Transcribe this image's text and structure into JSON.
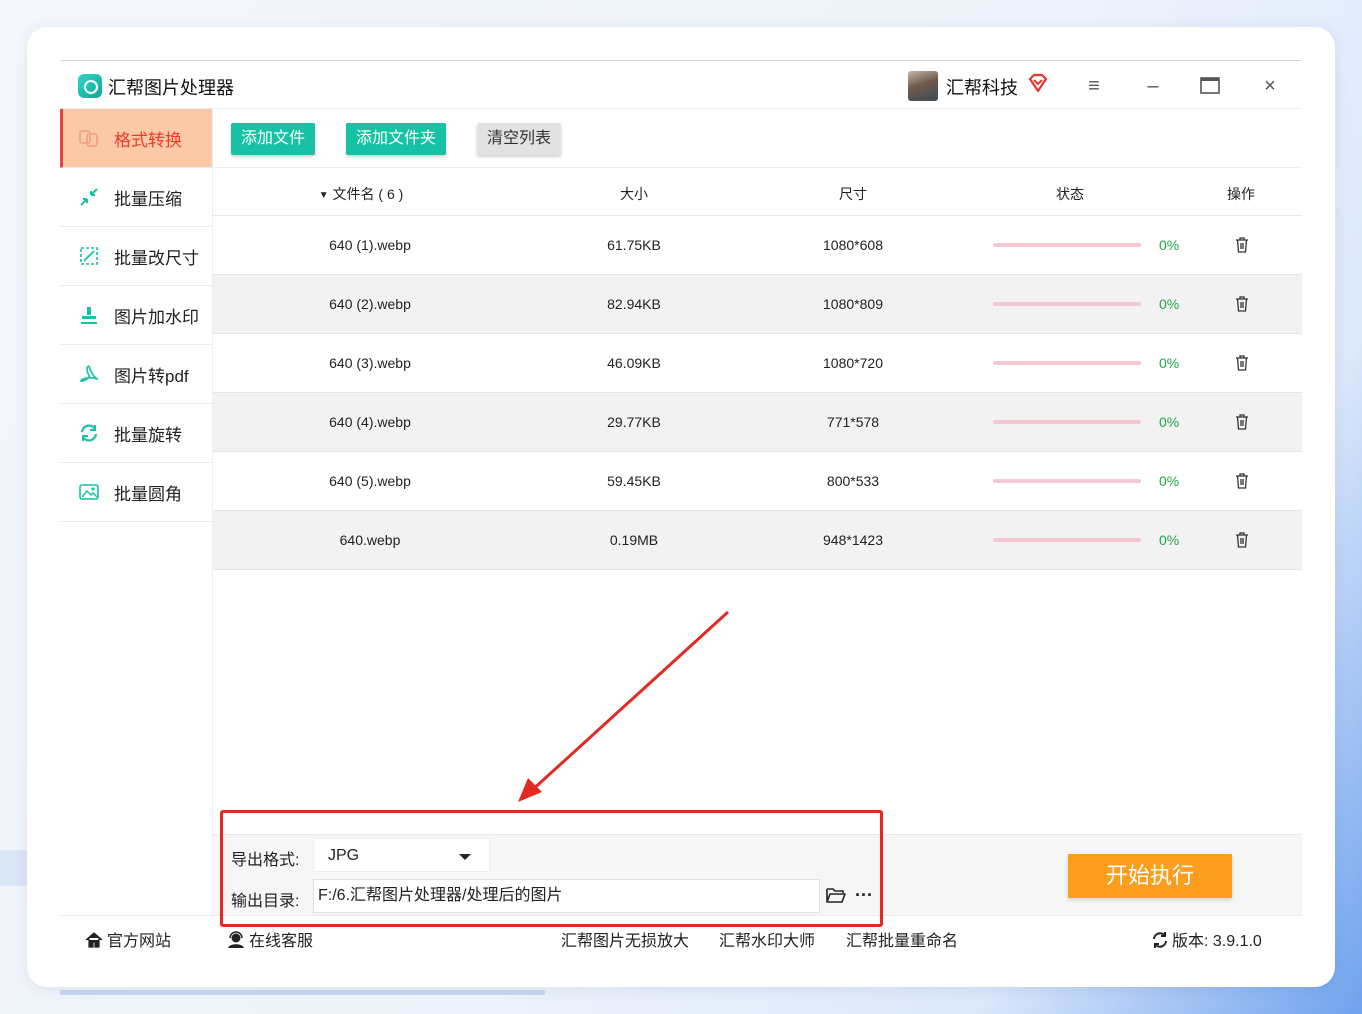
{
  "app": {
    "title": "汇帮图片处理器",
    "user_name": "汇帮科技"
  },
  "sidebar": {
    "items": [
      {
        "label": "格式转换",
        "icon": "format-convert-icon",
        "active": true
      },
      {
        "label": "批量压缩",
        "icon": "compress-icon",
        "active": false
      },
      {
        "label": "批量改尺寸",
        "icon": "resize-icon",
        "active": false
      },
      {
        "label": "图片加水印",
        "icon": "watermark-icon",
        "active": false
      },
      {
        "label": "图片转pdf",
        "icon": "pdf-icon",
        "active": false
      },
      {
        "label": "批量旋转",
        "icon": "rotate-icon",
        "active": false
      },
      {
        "label": "批量圆角",
        "icon": "round-corner-icon",
        "active": false
      }
    ]
  },
  "toolbar": {
    "add_file": "添加文件",
    "add_folder": "添加文件夹",
    "clear_list": "清空列表"
  },
  "table": {
    "headers": {
      "name": "文件名 ( 6 )",
      "size": "大小",
      "dims": "尺寸",
      "status": "状态",
      "ops": "操作"
    },
    "rows": [
      {
        "name": "640 (1).webp",
        "size": "61.75KB",
        "dims": "1080*608",
        "progress": "0%"
      },
      {
        "name": "640 (2).webp",
        "size": "82.94KB",
        "dims": "1080*809",
        "progress": "0%"
      },
      {
        "name": "640 (3).webp",
        "size": "46.09KB",
        "dims": "1080*720",
        "progress": "0%"
      },
      {
        "name": "640 (4).webp",
        "size": "29.77KB",
        "dims": "771*578",
        "progress": "0%"
      },
      {
        "name": "640 (5).webp",
        "size": "59.45KB",
        "dims": "800*533",
        "progress": "0%"
      },
      {
        "name": "640.webp",
        "size": "0.19MB",
        "dims": "948*1423",
        "progress": "0%"
      }
    ]
  },
  "export": {
    "format_label": "导出格式:",
    "format_value": "JPG",
    "output_label": "输出目录:",
    "output_path": "F:/6.汇帮图片处理器/处理后的图片",
    "start_button": "开始执行"
  },
  "footer": {
    "website": "官方网站",
    "service": "在线客服",
    "link1": "汇帮图片无损放大",
    "link2": "汇帮水印大师",
    "link3": "汇帮批量重命名",
    "version": "版本: 3.9.1.0"
  },
  "colors": {
    "accent_teal": "#17c1a4",
    "start_orange": "#fb9d1d",
    "active_tab_bg": "#fbc9a7",
    "active_tab_text": "#ef3b2a",
    "annotation_red": "#e22a22",
    "progress_pct": "#1fa64a"
  }
}
